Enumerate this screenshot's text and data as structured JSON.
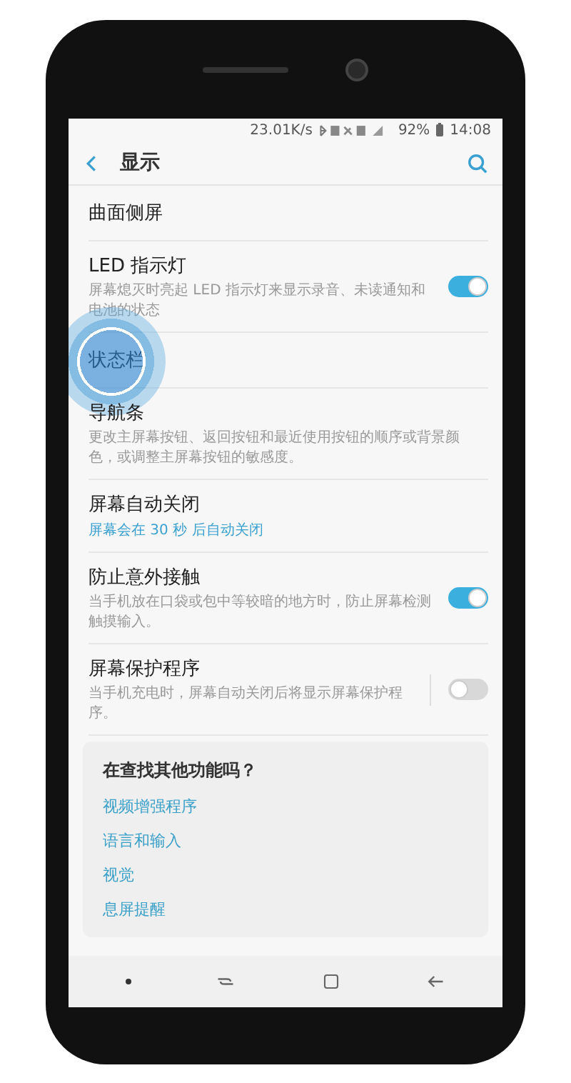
{
  "status_bar": {
    "network_speed": "23.01K/s",
    "battery": "92%",
    "time": "14:08"
  },
  "app_bar": {
    "title": "显示"
  },
  "settings": [
    {
      "kind": "plain",
      "title": "曲面侧屏"
    },
    {
      "kind": "toggle",
      "title": "LED 指示灯",
      "description": "屏幕熄灭时亮起 LED 指示灯来显示录音、未读通知和电池的状态",
      "on": true,
      "divider": false
    },
    {
      "kind": "plain",
      "title": "状态栏",
      "touched": true
    },
    {
      "kind": "plain",
      "title": "导航条",
      "description": "更改主屏幕按钮、返回按钮和最近使用按钮的顺序或背景颜色，或调整主屏幕按钮的敏感度。"
    },
    {
      "kind": "value",
      "title": "屏幕自动关闭",
      "value": "屏幕会在 30 秒 后自动关闭"
    },
    {
      "kind": "toggle",
      "title": "防止意外接触",
      "description": "当手机放在口袋或包中等较暗的地方时，防止屏幕检测触摸输入。",
      "on": true,
      "divider": false
    },
    {
      "kind": "toggle",
      "title": "屏幕保护程序",
      "description": "当手机充电时，屏幕自动关闭后将显示屏幕保护程序。",
      "on": false,
      "divider": true
    }
  ],
  "suggestions": {
    "title": "在查找其他功能吗？",
    "links": [
      "视频增强程序",
      "语言和输入",
      "视觉",
      "息屏提醒"
    ]
  }
}
